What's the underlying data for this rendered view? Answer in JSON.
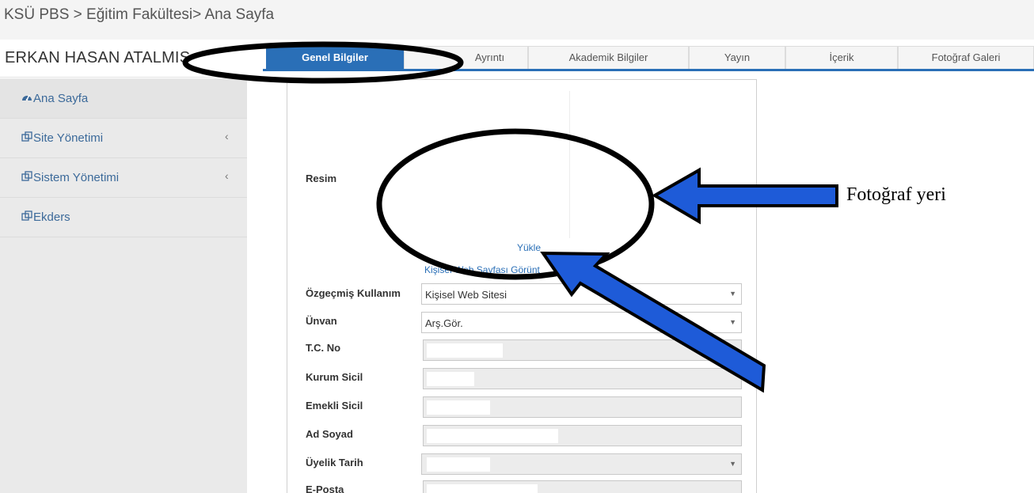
{
  "header": {
    "breadcrumb": "KSÜ PBS > Eğitim Fakültesi> Ana Sayfa"
  },
  "user": {
    "name": "ERKAN HASAN ATALMIŞ"
  },
  "sidebar": {
    "items": [
      {
        "label": "Ana Sayfa",
        "icon": "dashboard-icon"
      },
      {
        "label": "Site Yönetimi",
        "icon": "copy-icon",
        "chevron": "‹"
      },
      {
        "label": "Sistem Yönetimi",
        "icon": "copy-icon",
        "chevron": "‹"
      },
      {
        "label": "Ekders",
        "icon": "copy-icon"
      }
    ]
  },
  "tabs": [
    {
      "label": "Genel Bilgiler",
      "active": true
    },
    {
      "label": "Ayrıntı"
    },
    {
      "label": "Akademik Bilgiler"
    },
    {
      "label": "Yayın"
    },
    {
      "label": "İçerik"
    },
    {
      "label": "Fotoğraf Galeri"
    }
  ],
  "form": {
    "resim_label": "Resim",
    "upload_link": "Yükle",
    "web_link": "Kişisel Web Sayfası Görünt",
    "fields": {
      "ozgecmis": {
        "label": "Özgeçmiş Kullanım",
        "value": "Kişisel Web Sitesi"
      },
      "unvan": {
        "label": "Ünvan",
        "value": "Arş.Gör."
      },
      "tc": {
        "label": "T.C. No"
      },
      "kurum_sicil": {
        "label": "Kurum Sicil"
      },
      "emekli_sicil": {
        "label": "Emekli Sicil"
      },
      "ad_soyad": {
        "label": "Ad Soyad"
      },
      "uyelik_tarih": {
        "label": "Üyelik Tarih"
      },
      "eposta": {
        "label": "E-Posta"
      }
    }
  },
  "annotation": {
    "label": "Fotoğraf yeri",
    "arrow_color": "#1e5bd8"
  },
  "colors": {
    "accent": "#2a6fb7",
    "sidebar_bg": "#eaeaea",
    "link": "#2a6fb7"
  }
}
